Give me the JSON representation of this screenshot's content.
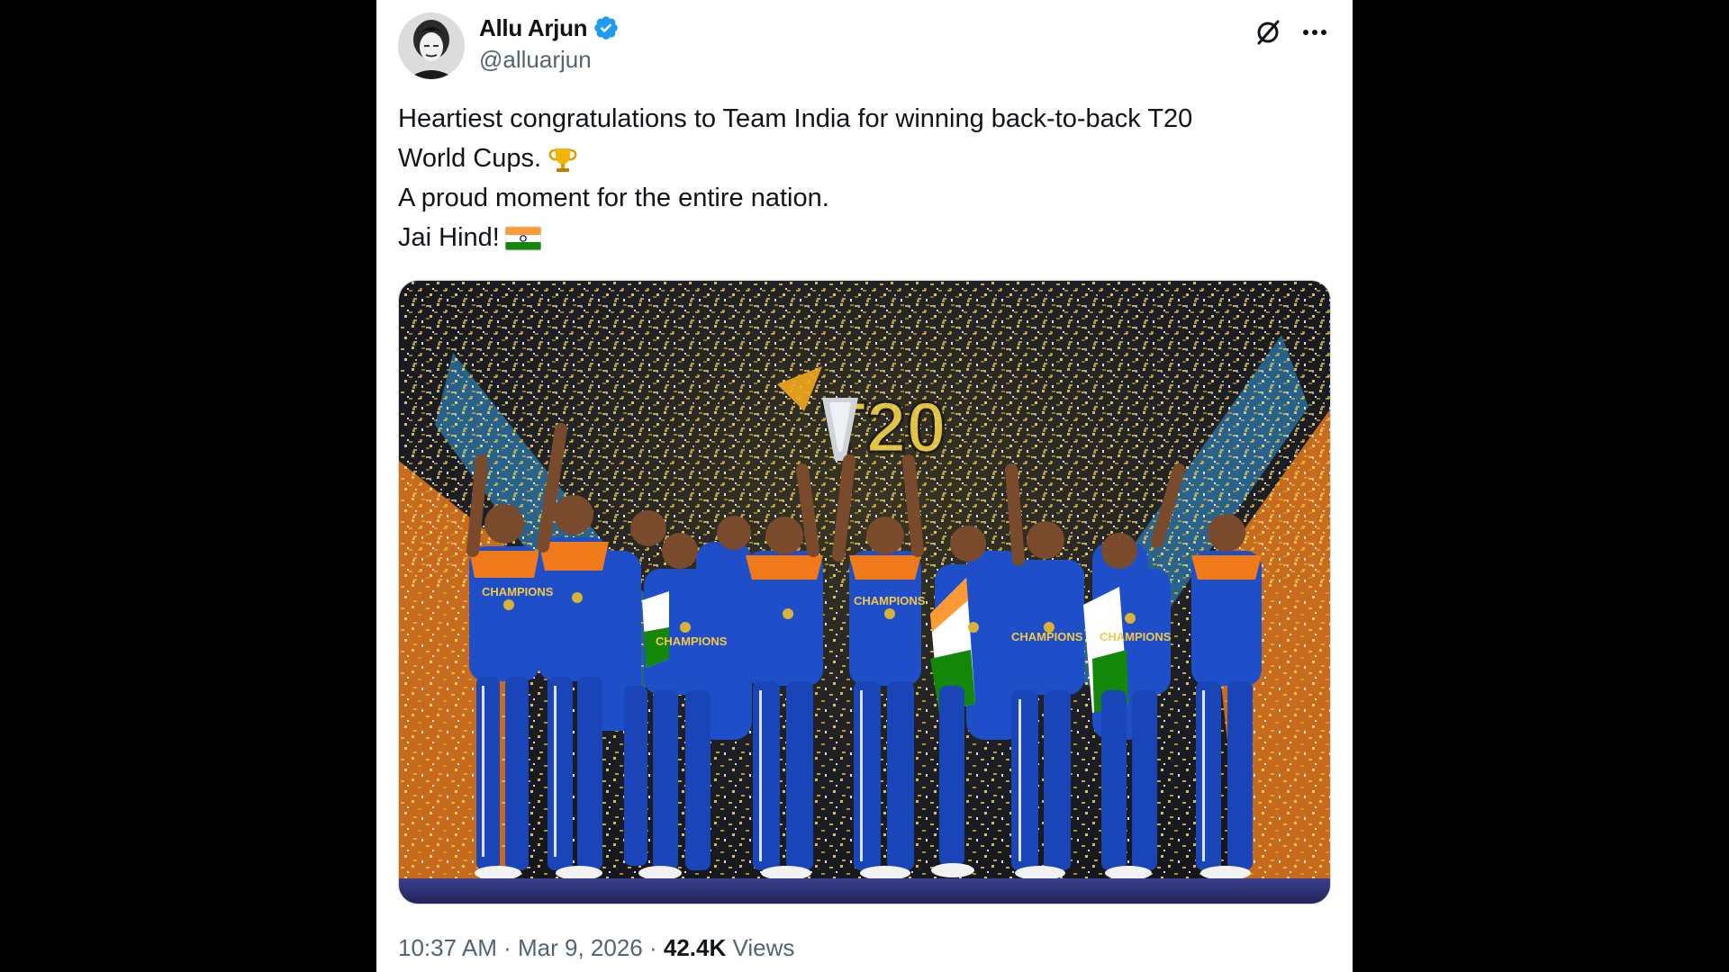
{
  "tweet": {
    "author": {
      "display_name": "Allu Arjun",
      "handle": "@alluarjun",
      "verified": true,
      "verified_color": "#1d9bf0"
    },
    "text_lines": [
      "Heartiest congratulations to Team India for winning back-to-back T20",
      "World Cups.",
      "A proud moment for the entire nation.",
      "Jai Hind!"
    ],
    "emojis": [
      "trophy-emoji",
      "india-flag-emoji"
    ],
    "media": {
      "type": "photo",
      "scene_text": "CHAMPIONS"
    },
    "meta": {
      "time": "10:37 AM",
      "separator": "·",
      "date": "Mar 9, 2026",
      "views_count": "42.4K",
      "views_label": "Views"
    },
    "icons": [
      "grok-icon",
      "more-options-icon",
      "verified-badge-icon"
    ]
  },
  "colors": {
    "background": "#000000",
    "card": "#ffffff",
    "text_primary": "#0f1419",
    "text_secondary": "#536471",
    "jersey_blue": "#1f4fc8",
    "jersey_orange": "#f07a1a",
    "confetti_gold": "#d4b12a"
  }
}
